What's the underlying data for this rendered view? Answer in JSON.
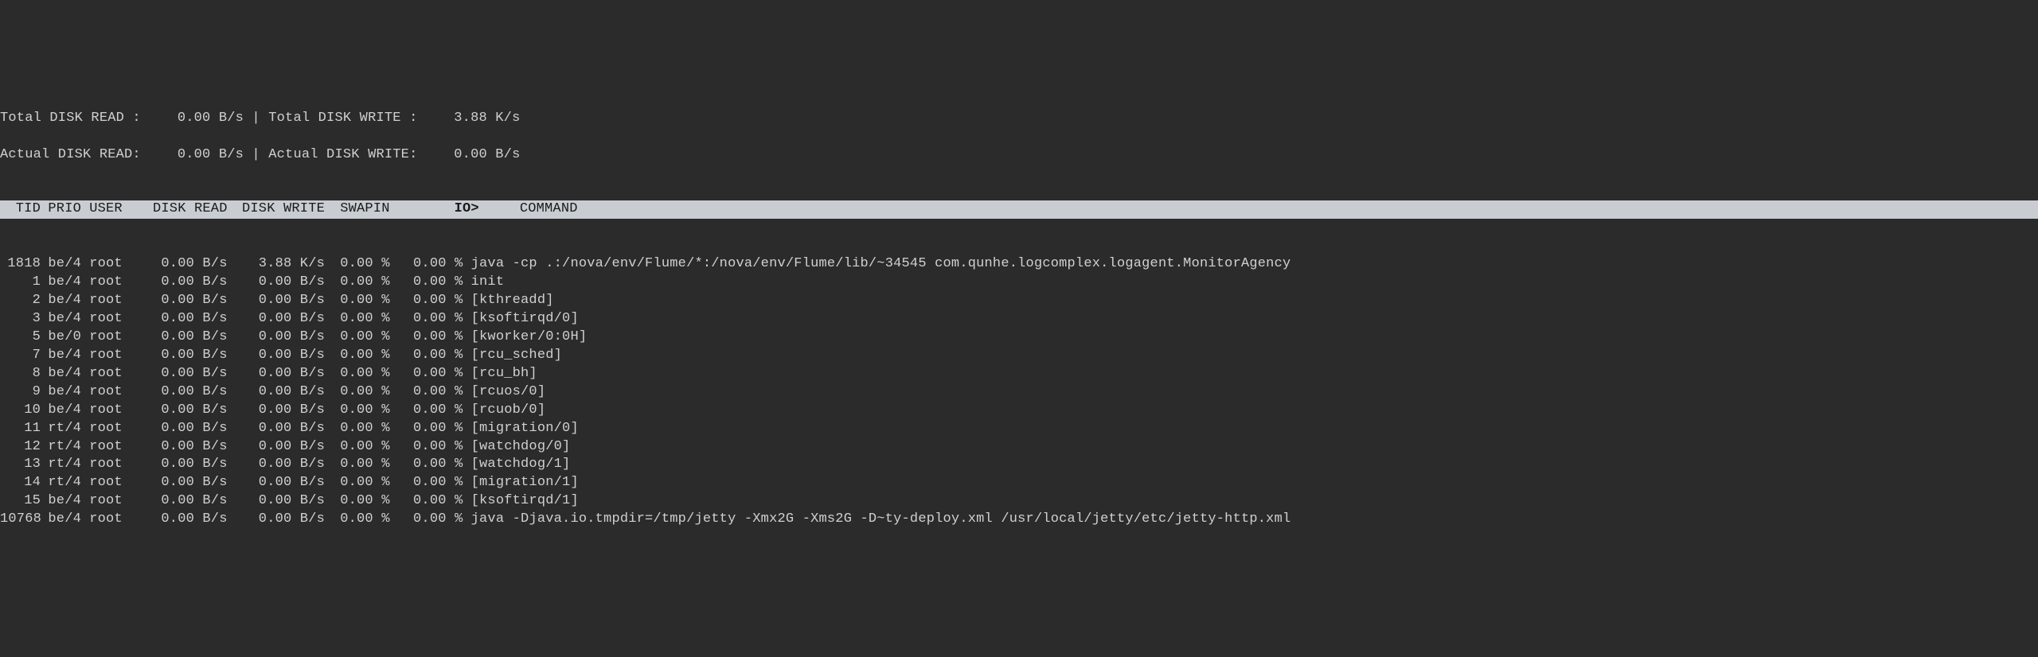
{
  "summary": {
    "total_read_label": "Total DISK READ :",
    "total_read_value": "0.00 B/s",
    "divider": " | ",
    "total_write_label": "Total DISK WRITE :",
    "total_write_value": "3.88 K/s",
    "actual_read_label": "Actual DISK READ:",
    "actual_read_value": "0.00 B/s",
    "actual_write_label": "Actual DISK WRITE:",
    "actual_write_value": "0.00 B/s"
  },
  "headers": {
    "tid": "TID",
    "prio": "PRIO",
    "user": "USER",
    "disk_read": "DISK READ",
    "disk_write": "DISK WRITE",
    "swapin": "SWAPIN",
    "io": "IO>",
    "command": "COMMAND"
  },
  "rows": [
    {
      "tid": "1818",
      "prio": "be/4",
      "user": "root",
      "read": "0.00 B/s",
      "write": "3.88 K/s",
      "swapin": "0.00 %",
      "io": "0.00 %",
      "cmd": "java -cp .:/nova/env/Flume/*:/nova/env/Flume/lib/~34545 com.qunhe.logcomplex.logagent.MonitorAgency"
    },
    {
      "tid": "1",
      "prio": "be/4",
      "user": "root",
      "read": "0.00 B/s",
      "write": "0.00 B/s",
      "swapin": "0.00 %",
      "io": "0.00 %",
      "cmd": "init"
    },
    {
      "tid": "2",
      "prio": "be/4",
      "user": "root",
      "read": "0.00 B/s",
      "write": "0.00 B/s",
      "swapin": "0.00 %",
      "io": "0.00 %",
      "cmd": "[kthreadd]"
    },
    {
      "tid": "3",
      "prio": "be/4",
      "user": "root",
      "read": "0.00 B/s",
      "write": "0.00 B/s",
      "swapin": "0.00 %",
      "io": "0.00 %",
      "cmd": "[ksoftirqd/0]"
    },
    {
      "tid": "5",
      "prio": "be/0",
      "user": "root",
      "read": "0.00 B/s",
      "write": "0.00 B/s",
      "swapin": "0.00 %",
      "io": "0.00 %",
      "cmd": "[kworker/0:0H]"
    },
    {
      "tid": "7",
      "prio": "be/4",
      "user": "root",
      "read": "0.00 B/s",
      "write": "0.00 B/s",
      "swapin": "0.00 %",
      "io": "0.00 %",
      "cmd": "[rcu_sched]"
    },
    {
      "tid": "8",
      "prio": "be/4",
      "user": "root",
      "read": "0.00 B/s",
      "write": "0.00 B/s",
      "swapin": "0.00 %",
      "io": "0.00 %",
      "cmd": "[rcu_bh]"
    },
    {
      "tid": "9",
      "prio": "be/4",
      "user": "root",
      "read": "0.00 B/s",
      "write": "0.00 B/s",
      "swapin": "0.00 %",
      "io": "0.00 %",
      "cmd": "[rcuos/0]"
    },
    {
      "tid": "10",
      "prio": "be/4",
      "user": "root",
      "read": "0.00 B/s",
      "write": "0.00 B/s",
      "swapin": "0.00 %",
      "io": "0.00 %",
      "cmd": "[rcuob/0]"
    },
    {
      "tid": "11",
      "prio": "rt/4",
      "user": "root",
      "read": "0.00 B/s",
      "write": "0.00 B/s",
      "swapin": "0.00 %",
      "io": "0.00 %",
      "cmd": "[migration/0]"
    },
    {
      "tid": "12",
      "prio": "rt/4",
      "user": "root",
      "read": "0.00 B/s",
      "write": "0.00 B/s",
      "swapin": "0.00 %",
      "io": "0.00 %",
      "cmd": "[watchdog/0]"
    },
    {
      "tid": "13",
      "prio": "rt/4",
      "user": "root",
      "read": "0.00 B/s",
      "write": "0.00 B/s",
      "swapin": "0.00 %",
      "io": "0.00 %",
      "cmd": "[watchdog/1]"
    },
    {
      "tid": "14",
      "prio": "rt/4",
      "user": "root",
      "read": "0.00 B/s",
      "write": "0.00 B/s",
      "swapin": "0.00 %",
      "io": "0.00 %",
      "cmd": "[migration/1]"
    },
    {
      "tid": "15",
      "prio": "be/4",
      "user": "root",
      "read": "0.00 B/s",
      "write": "0.00 B/s",
      "swapin": "0.00 %",
      "io": "0.00 %",
      "cmd": "[ksoftirqd/1]"
    },
    {
      "tid": "10768",
      "prio": "be/4",
      "user": "root",
      "read": "0.00 B/s",
      "write": "0.00 B/s",
      "swapin": "0.00 %",
      "io": "0.00 %",
      "cmd": "java -Djava.io.tmpdir=/tmp/jetty -Xmx2G -Xms2G -D~ty-deploy.xml /usr/local/jetty/etc/jetty-http.xml"
    }
  ]
}
